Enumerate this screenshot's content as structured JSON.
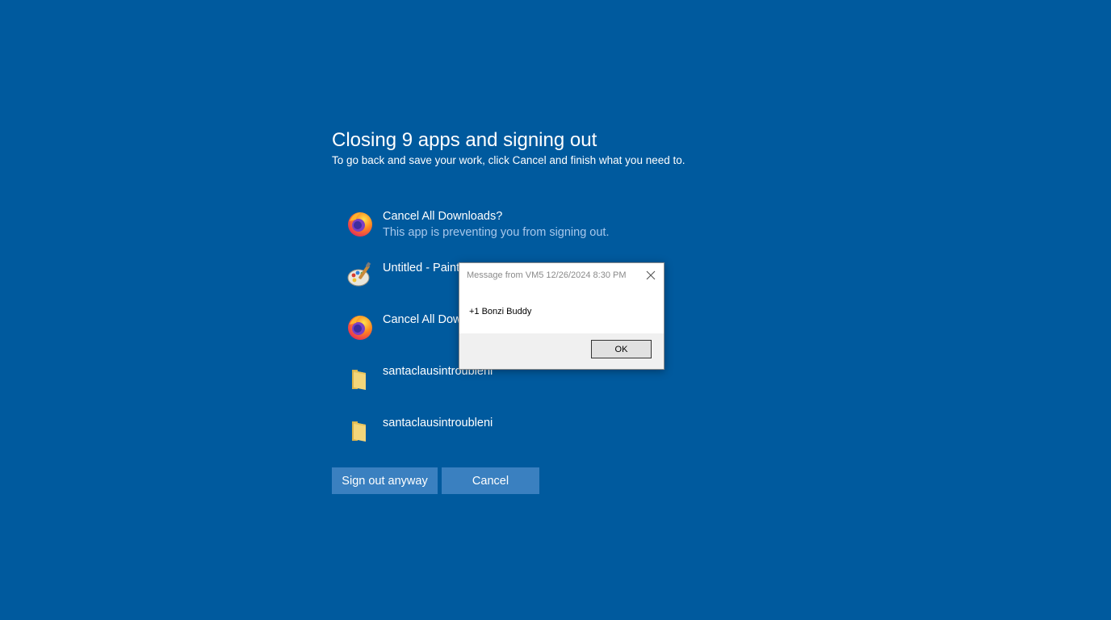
{
  "signout": {
    "title": "Closing 9 apps and signing out",
    "subtitle": "To go back and save your work, click Cancel and finish what you need to."
  },
  "apps": [
    {
      "name": "Cancel All Downloads?",
      "status": "This app is preventing you from signing out.",
      "icon": "firefox-icon"
    },
    {
      "name": "Untitled - Paint",
      "status": "",
      "icon": "paint-icon"
    },
    {
      "name": "Cancel All Downloads?",
      "status": "",
      "icon": "firefox-icon"
    },
    {
      "name": "santaclausintroubleni",
      "status": "",
      "icon": "folder-icon"
    },
    {
      "name": "santaclausintroubleni",
      "status": "",
      "icon": "folder-icon"
    }
  ],
  "buttons": {
    "signout_label": "Sign out anyway",
    "cancel_label": "Cancel"
  },
  "message_box": {
    "title": "Message from VM5 12/26/2024 8:30 PM",
    "body": "+1 Bonzi Buddy",
    "ok_label": "OK"
  },
  "colors": {
    "background": "#005a9e",
    "button": "#3a80c0",
    "status_text": "#a8c8ec"
  }
}
